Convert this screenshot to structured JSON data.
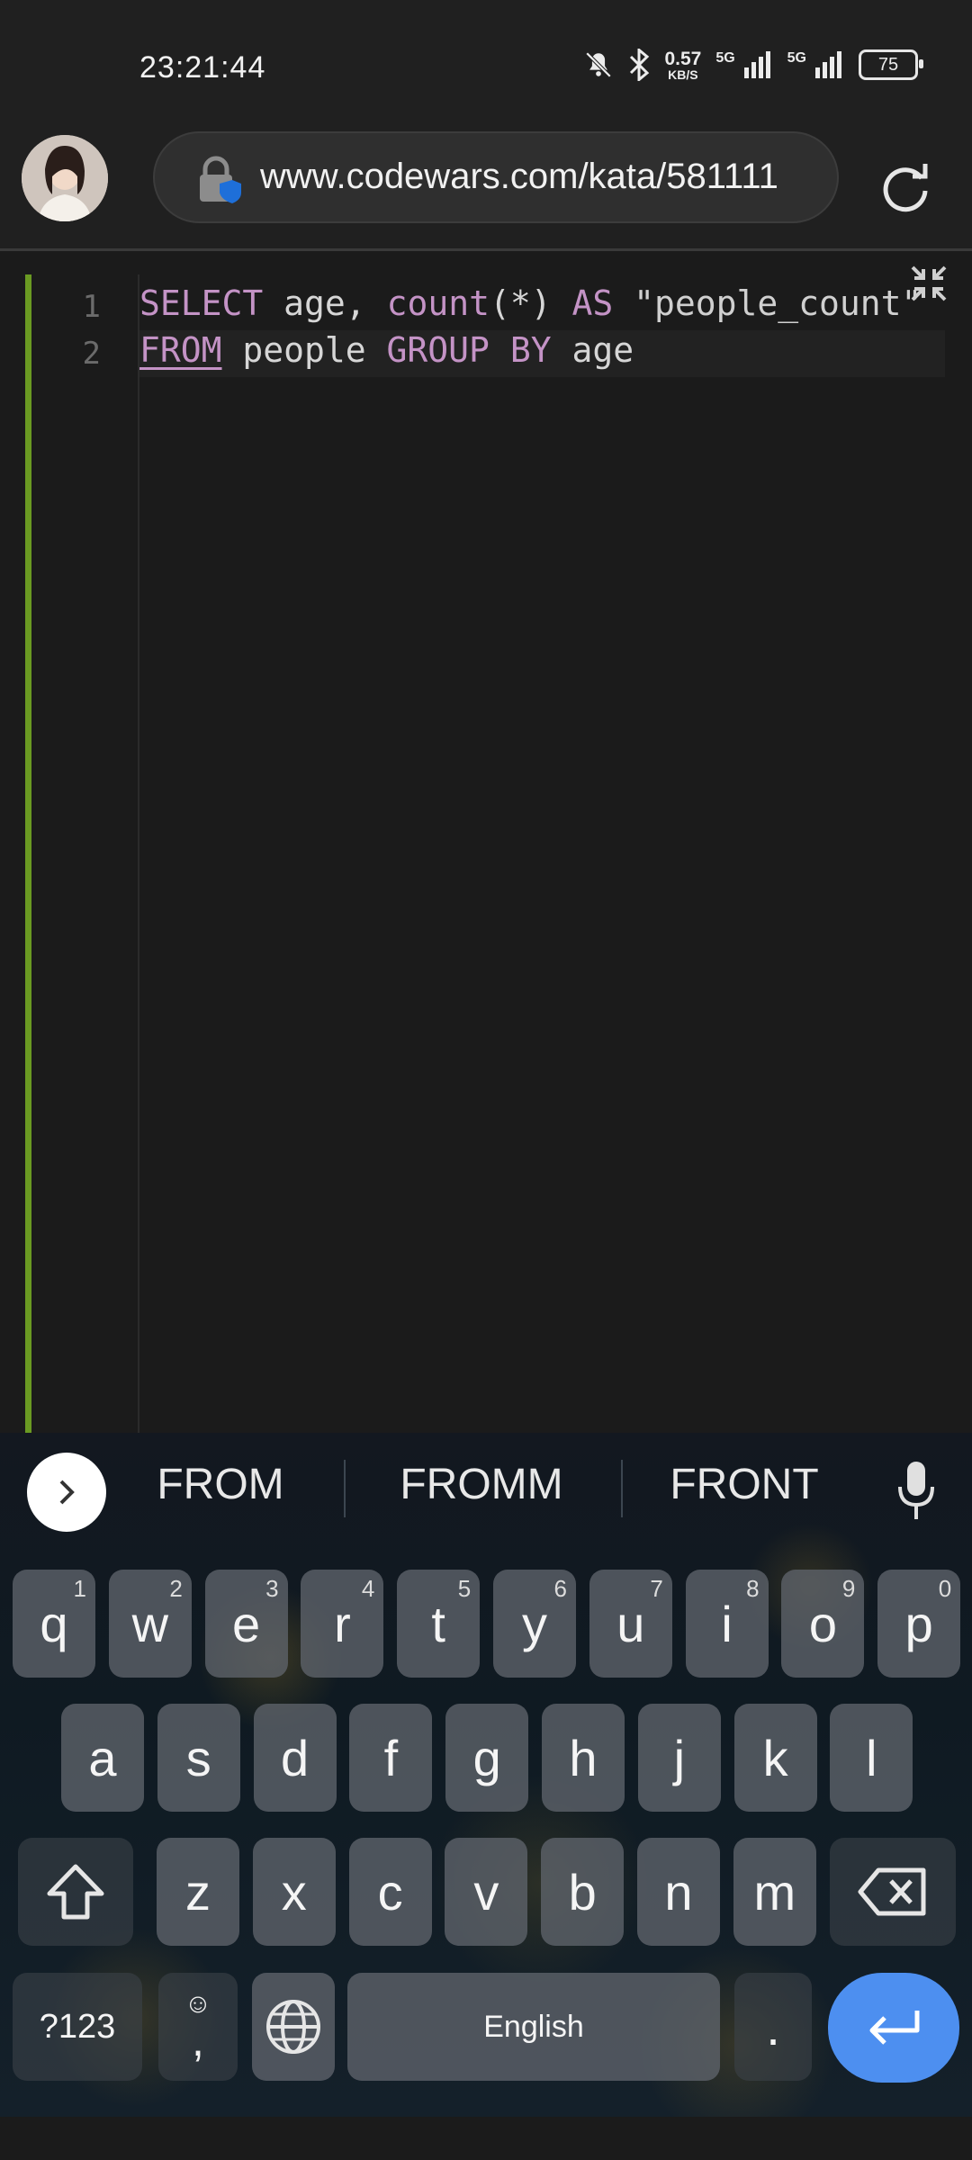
{
  "status_bar": {
    "time": "23:21:44",
    "net_speed_value": "0.57",
    "net_speed_unit": "KB/S",
    "signal1_label": "5G",
    "signal2_label": "5G",
    "battery": "75"
  },
  "browser": {
    "url": "www.codewars.com/kata/581111"
  },
  "editor": {
    "line_numbers": [
      "1",
      "2"
    ],
    "lines": [
      [
        {
          "text": "SELECT",
          "cls": "kw"
        },
        {
          "text": " age, ",
          "cls": ""
        },
        {
          "text": "count",
          "cls": "fn"
        },
        {
          "text": "(*) ",
          "cls": ""
        },
        {
          "text": "AS",
          "cls": "kw"
        },
        {
          "text": " \"people_count\"",
          "cls": "str"
        }
      ],
      [
        {
          "text": "FROM",
          "cls": "kw underline"
        },
        {
          "text": " people ",
          "cls": ""
        },
        {
          "text": "GROUP BY",
          "cls": "kw"
        },
        {
          "text": " age",
          "cls": ""
        }
      ]
    ]
  },
  "keyboard": {
    "suggestions": [
      "FROM",
      "FROMM",
      "FRONT"
    ],
    "row1": [
      {
        "letter": "q",
        "num": "1"
      },
      {
        "letter": "w",
        "num": "2"
      },
      {
        "letter": "e",
        "num": "3"
      },
      {
        "letter": "r",
        "num": "4"
      },
      {
        "letter": "t",
        "num": "5"
      },
      {
        "letter": "y",
        "num": "6"
      },
      {
        "letter": "u",
        "num": "7"
      },
      {
        "letter": "i",
        "num": "8"
      },
      {
        "letter": "o",
        "num": "9"
      },
      {
        "letter": "p",
        "num": "0"
      }
    ],
    "row2": [
      "a",
      "s",
      "d",
      "f",
      "g",
      "h",
      "j",
      "k",
      "l"
    ],
    "row3": [
      "z",
      "x",
      "c",
      "v",
      "b",
      "n",
      "m"
    ],
    "symbols_label": "?123",
    "comma_label": ",",
    "emoji_label": "☺",
    "space_label": "English",
    "period_label": "."
  },
  "colors": {
    "accent_bar": "#6a9a22",
    "keyword": "#c493c6",
    "enter_key": "#4d8ff0"
  }
}
